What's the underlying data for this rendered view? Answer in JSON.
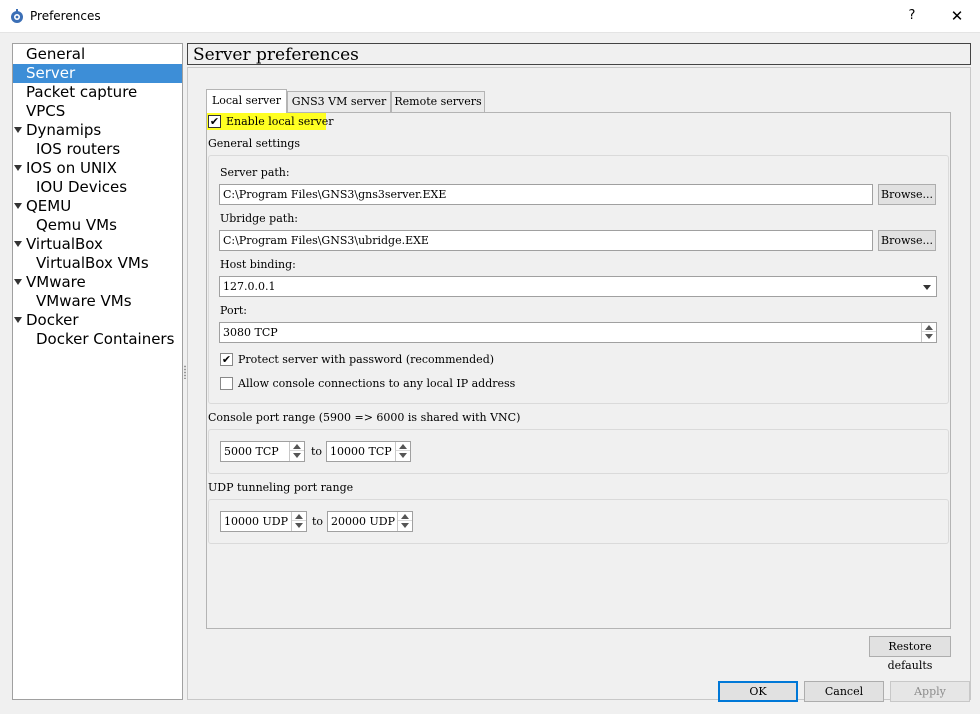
{
  "window": {
    "title": "Preferences",
    "help_label": "?",
    "close_label": "✕"
  },
  "sidebar": {
    "items": [
      {
        "label": "General"
      },
      {
        "label": "Server",
        "selected": true
      },
      {
        "label": "Packet capture"
      },
      {
        "label": "VPCS"
      },
      {
        "label": "Dynamips",
        "expanded": true
      },
      {
        "label": "IOS routers"
      },
      {
        "label": "IOS on UNIX",
        "expanded": true
      },
      {
        "label": "IOU Devices"
      },
      {
        "label": "QEMU",
        "expanded": true
      },
      {
        "label": "Qemu VMs"
      },
      {
        "label": "VirtualBox",
        "expanded": true
      },
      {
        "label": "VirtualBox VMs"
      },
      {
        "label": "VMware",
        "expanded": true
      },
      {
        "label": "VMware VMs"
      },
      {
        "label": "Docker",
        "expanded": true
      },
      {
        "label": "Docker Containers"
      }
    ]
  },
  "page": {
    "title": "Server preferences"
  },
  "tabs": [
    {
      "label": "Local server",
      "active": true
    },
    {
      "label": "GNS3 VM server"
    },
    {
      "label": "Remote servers"
    }
  ],
  "local": {
    "enable_label": "Enable local server",
    "enable_checked": true,
    "check_glyph": "✔",
    "general_settings_label": "General settings",
    "server_path_label": "Server path:",
    "server_path_value": "C:\\Program Files\\GNS3\\gns3server.EXE",
    "ubridge_path_label": "Ubridge path:",
    "ubridge_path_value": "C:\\Program Files\\GNS3\\ubridge.EXE",
    "browse_label": "Browse...",
    "host_binding_label": "Host binding:",
    "host_binding_value": "127.0.0.1",
    "port_label": "Port:",
    "port_value": "3080 TCP",
    "protect_label": "Protect server with password (recommended)",
    "protect_checked": true,
    "allow_console_label": "Allow console connections to any local IP address",
    "allow_console_checked": false,
    "console_range_label": "Console port range (5900 => 6000 is shared with VNC)",
    "console_start": "5000 TCP",
    "console_end": "10000 TCP",
    "to_label": "to",
    "udp_range_label": "UDP tunneling port range",
    "udp_start": "10000 UDP",
    "udp_end": "20000 UDP"
  },
  "footer": {
    "restore_label": "Restore defaults",
    "ok_label": "OK",
    "cancel_label": "Cancel",
    "apply_label": "Apply"
  },
  "colors": {
    "selection": "#3d8ed7",
    "highlight": "#ffff22",
    "default_button_border": "#0078d7"
  }
}
